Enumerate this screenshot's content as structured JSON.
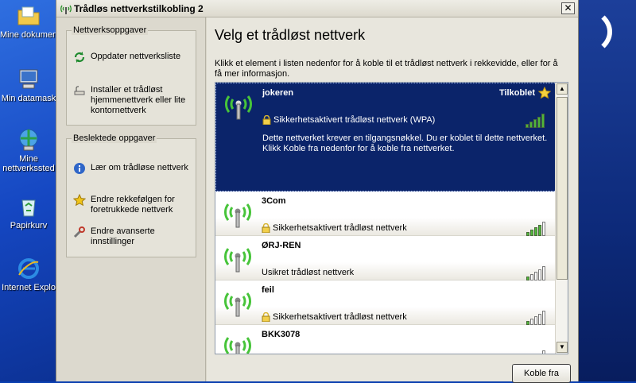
{
  "window": {
    "title": "Trådløs nettverkstilkobling 2",
    "close_glyph": "✕"
  },
  "desktop": {
    "icons": [
      {
        "label": "Mine dokument",
        "icon": "my-documents-icon"
      },
      {
        "label": "Min datamask",
        "icon": "my-computer-icon"
      },
      {
        "label": "Mine",
        "label2": "nettverkssted",
        "icon": "network-places-icon"
      },
      {
        "label": "Papirkurv",
        "icon": "recycle-bin-icon"
      },
      {
        "label": "Internet Explo",
        "icon": "internet-explorer-icon"
      }
    ]
  },
  "sidebar": {
    "network_tasks": {
      "title": "Nettverksoppgaver",
      "items": [
        {
          "label": "Oppdater nettverksliste",
          "icon": "refresh-icon"
        },
        {
          "label": "Installer et trådløst hjemmenettverk eller lite kontornettverk",
          "icon": "wireless-setup-icon"
        }
      ]
    },
    "related_tasks": {
      "title": "Beslektede oppgaver",
      "items": [
        {
          "label": "Lær om trådløse nettverk",
          "icon": "info-icon"
        },
        {
          "label": "Endre rekkefølgen for foretrukkede nettverk",
          "icon": "star-icon"
        },
        {
          "label": "Endre avanserte innstillinger",
          "icon": "settings-icon"
        }
      ]
    }
  },
  "main": {
    "heading": "Velg et trådløst nettverk",
    "description": "Klikk et element i listen nedenfor for å koble til et trådløst nettverk i rekkevidde, eller for å få mer informasjon.",
    "connect_button": "Koble fra"
  },
  "networks": [
    {
      "name": "jokeren",
      "security": "Sikkerhetsaktivert trådløst nettverk (WPA)",
      "secured": true,
      "status": "Tilkoblet",
      "signal": 5,
      "details": "Dette nettverket krever en tilgangsnøkkel. Du er koblet til dette nettverket. Klikk Koble fra nedenfor for å koble fra nettverket.",
      "selected": true
    },
    {
      "name": "3Com",
      "security": "Sikkerhetsaktivert trådløst nettverk",
      "secured": true,
      "signal": 4
    },
    {
      "name": "ØRJ-REN",
      "security": "Usikret trådløst nettverk",
      "secured": false,
      "signal": 1
    },
    {
      "name": "feil",
      "security": "Sikkerhetsaktivert trådløst nettverk",
      "secured": true,
      "signal": 1
    },
    {
      "name": "BKK3078",
      "security": "",
      "secured": false,
      "signal": 1
    }
  ],
  "colors": {
    "selected_bg": "#0b246a",
    "signal_on": "#4fb63a",
    "desktop_blue": "#1547c2"
  }
}
